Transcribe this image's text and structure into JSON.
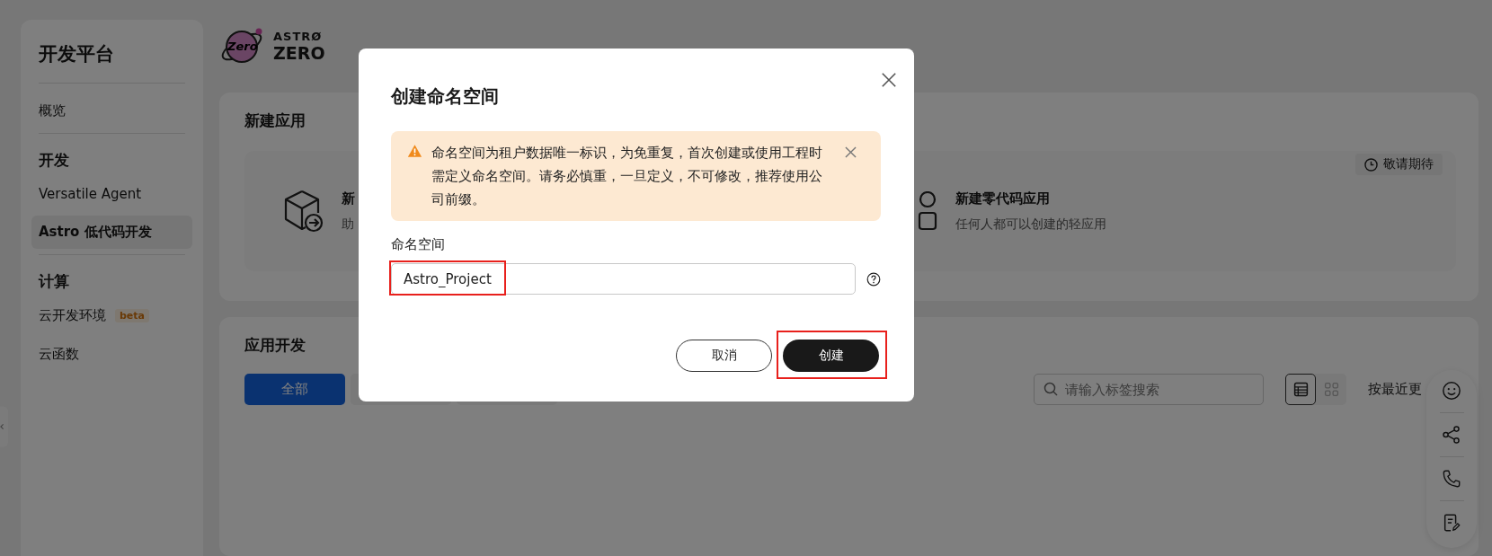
{
  "sidebar": {
    "title": "开发平台",
    "sections": [
      {
        "items": [
          {
            "label": "概览",
            "selected": false
          }
        ]
      },
      {
        "heading": "开发",
        "items": [
          {
            "label": "Versatile Agent",
            "selected": false
          },
          {
            "label": "Astro 低代码开发",
            "selected": true
          }
        ]
      },
      {
        "heading": "计算",
        "items": [
          {
            "label": "云开发环境",
            "badge": "beta",
            "selected": false
          },
          {
            "label": "云函数",
            "selected": false
          }
        ]
      }
    ]
  },
  "logo": {
    "badge": "Zero",
    "line1": "ASTRØ",
    "line2": "ZERO"
  },
  "new_app": {
    "title": "新建应用",
    "badge": "敬请期待",
    "cards": [
      {
        "kind": "cube",
        "title": "新",
        "description": "助"
      },
      {
        "kind": "shapes",
        "title": "新建零代码应用",
        "description": "任何人都可以创建的轻应用"
      }
    ]
  },
  "app_dev": {
    "title": "应用开发",
    "tabs": [
      {
        "label": "全部",
        "selected": true
      },
      {
        "selected": false
      },
      {
        "selected": false
      }
    ],
    "search": {
      "placeholder": "请输入标签搜索"
    },
    "views": [
      {
        "kind": "list",
        "selected": true
      },
      {
        "kind": "grid",
        "selected": false
      }
    ],
    "sort": "按最近更"
  },
  "float_toolbar": [
    {
      "kind": "smile"
    },
    {
      "kind": "share"
    },
    {
      "kind": "phone"
    },
    {
      "kind": "note"
    }
  ],
  "dialog": {
    "title": "创建命名空间",
    "alert": {
      "text": "命名空间为租户数据唯一标识，为免重复，首次创建或使用工程时需定义命名空间。请务必慎重，一旦定义，不可修改，推荐使用公司前缀。"
    },
    "field": {
      "label": "命名空间",
      "value": "Astro_Project",
      "highlighted": true
    },
    "buttons": [
      {
        "kind": "secondary",
        "label": "取消"
      },
      {
        "kind": "primary",
        "label": "创建",
        "highlighted": true
      }
    ]
  }
}
